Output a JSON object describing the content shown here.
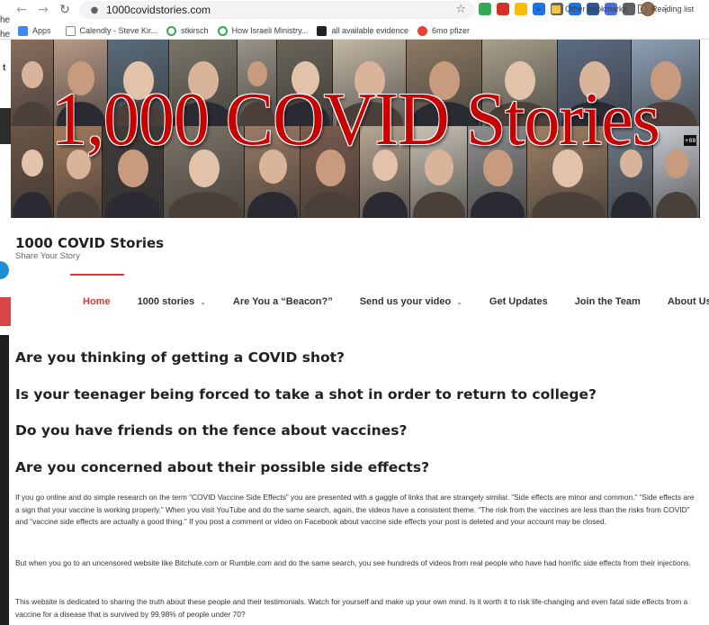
{
  "browser": {
    "url": "1000covidstories.com",
    "bookmarks": [
      {
        "label": "Apps",
        "icon": "apps-grid-icon",
        "color": "#4285f4"
      },
      {
        "label": "Calendly - Steve Kir...",
        "icon": "calendar-icon",
        "color": "#888888"
      },
      {
        "label": "stkirsch",
        "icon": "play-icon",
        "color": "#34a853"
      },
      {
        "label": "How Israeli Ministry...",
        "icon": "play-icon",
        "color": "#34a853"
      },
      {
        "label": "all available evidence",
        "icon": "t-logo-icon",
        "color": "#222222"
      },
      {
        "label": "6mo pfizer",
        "icon": "red-circle-icon",
        "color": "#ea4335"
      }
    ],
    "more_bookmarks": "»",
    "other_bookmarks": "Other bookmarks",
    "reading_list": "Reading list",
    "extensions": [
      "#34a853",
      "#d93025",
      "#fbbc04",
      "#1a73e8",
      "#5f6368",
      "#1a73e8",
      "#2b579a",
      "#4a6ee0",
      "#5f6368"
    ]
  },
  "slivers": {
    "line1": "he",
    "line2": "he",
    "line3": "t"
  },
  "banner": {
    "title": "1,000 COVID Stories",
    "badge": "+88"
  },
  "site": {
    "title": "1000 COVID Stories",
    "tagline": "Share Your Story"
  },
  "menu": [
    {
      "label": "Home",
      "current": true,
      "has_dropdown": false
    },
    {
      "label": "1000 stories",
      "current": false,
      "has_dropdown": true
    },
    {
      "label": "Are You a “Beacon?”",
      "current": false,
      "has_dropdown": false
    },
    {
      "label": "Send us your video",
      "current": false,
      "has_dropdown": true
    },
    {
      "label": "Get Updates",
      "current": false,
      "has_dropdown": false
    },
    {
      "label": "Join the Team",
      "current": false,
      "has_dropdown": false
    },
    {
      "label": "About Us",
      "current": false,
      "has_dropdown": false
    }
  ],
  "content": {
    "questions": [
      "Are you thinking of getting a COVID shot?",
      "Is your teenager being forced to take a shot in order to return to college?",
      "Do you have friends on the fence about vaccines?",
      "Are you concerned about their possible side effects?"
    ],
    "paragraphs": [
      "If you go online and do simple research on the term “COVID Vaccine Side Effects” you are presented with a gaggle of links that are strangely similar. “Side effects are minor and common.” “Side effects are a sign that your vaccine is working properly.” When you visit YouTube and do the same search, again, the videos have a consistent theme. “The risk from the vaccines are less than the risks from COVID” and “vaccine side effects are actually a good thing.” If you post a comment or video on Facebook about vaccine side effects your post is deleted and your account may be closed.",
      "But when you go to an uncensored website like Bitchute.com or Rumble.com and do the same search, you see hundreds of videos from real people who have had horrific side effects from their injections.",
      "This website is dedicated to sharing the truth about these people and their testimonials. Watch for yourself and make up your own mind. Is it worth it to risk life-changing and even fatal side effects from a vaccine for a disease that is survived by 99.98% of people under 70?"
    ]
  },
  "colors": {
    "accent": "#d33c31",
    "banner_title": "#c80000"
  }
}
